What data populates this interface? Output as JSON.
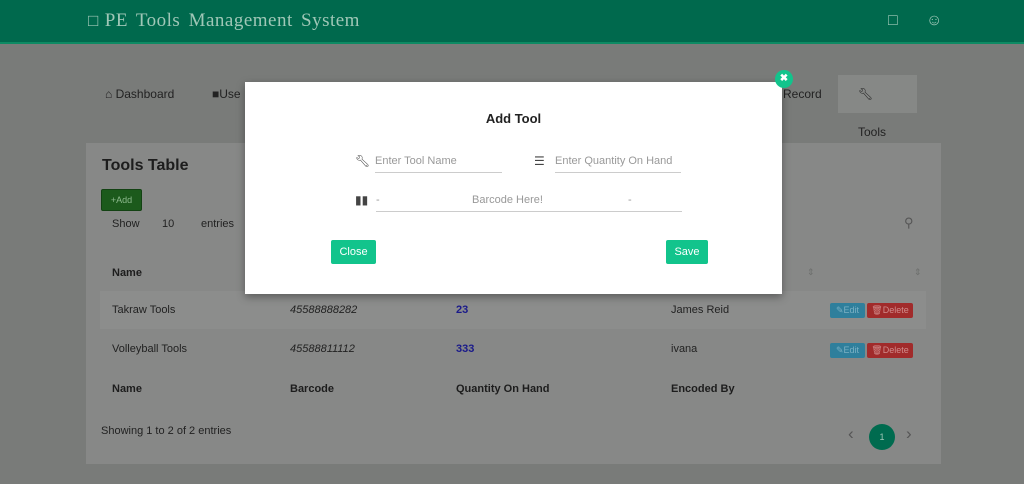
{
  "header": {
    "title": "PE Tools Management System",
    "icons": [
      "edit-icon",
      "user-icon"
    ]
  },
  "nav": {
    "items": [
      {
        "label": "Dashboard",
        "icon": "home-icon"
      },
      {
        "label": "Use",
        "icon": "user-icon"
      },
      {
        "label": "Record"
      },
      {
        "label": "Tools",
        "icon": "wrench-icon",
        "active": true
      }
    ]
  },
  "card": {
    "title": "Tools Table",
    "add_label": "Add",
    "show_label": "Show",
    "entries_value": "10",
    "entries_label": "entries",
    "columns": [
      "Name",
      "Barcode",
      "Quantity On Hand",
      "Encoded By"
    ],
    "rows": [
      {
        "name": "Takraw Tools",
        "barcode": "45588888282",
        "qty": "23",
        "encoded_by": "James Reid"
      },
      {
        "name": "Volleyball Tools",
        "barcode": "45588811112",
        "qty": "333",
        "encoded_by": "ivana"
      }
    ],
    "edit_label": "Edit",
    "delete_label": "Delete",
    "info": "Showing 1 to 2 of 2 entries",
    "page": "1"
  },
  "modal": {
    "title": "Add Tool",
    "tool_name_placeholder": "Enter Tool Name",
    "qty_placeholder": "Enter Quantity On Hand",
    "barcode_placeholder": "Barcode Here!",
    "barcode_left": "-",
    "barcode_right": "-",
    "close_label": "Close",
    "save_label": "Save"
  },
  "colors": {
    "header": "#00694d",
    "accent": "#12c48c",
    "danger": "#a12b2b",
    "info": "#2f7f9c"
  }
}
